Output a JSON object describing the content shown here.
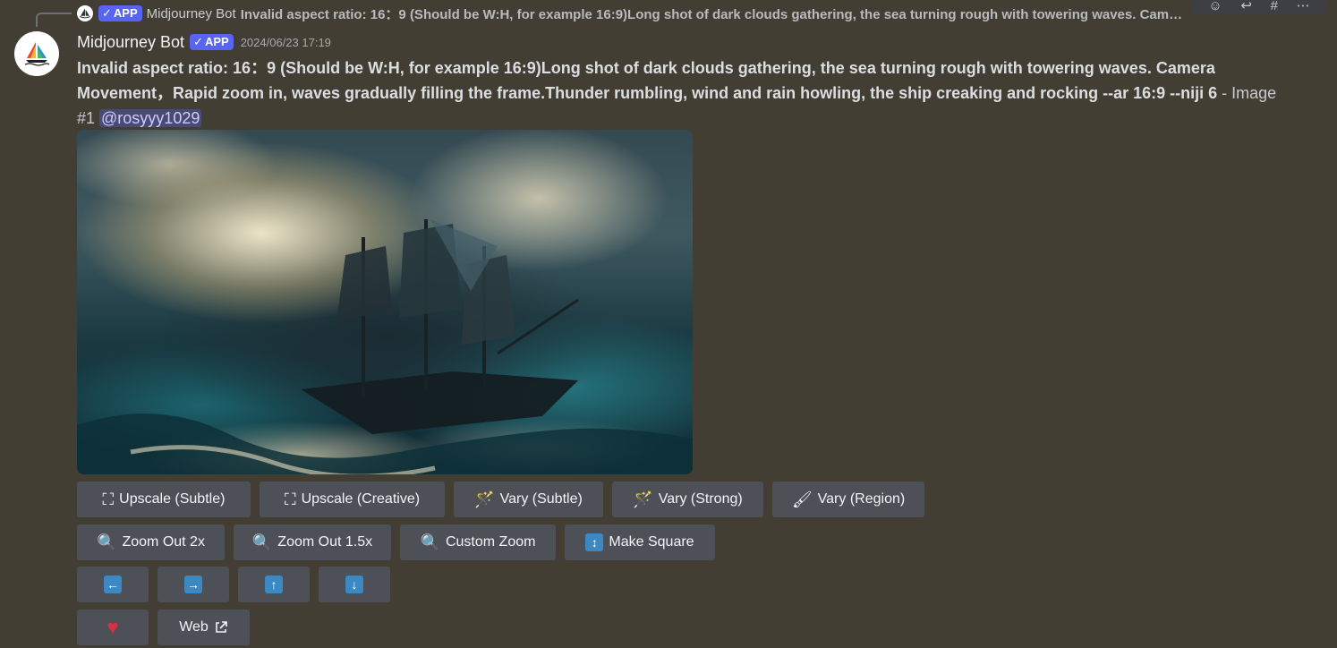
{
  "reply": {
    "badge": "APP",
    "author": "Midjourney Bot",
    "text": "Invalid aspect ratio: 16：9 (Should be W:H, for example 16:9)Long shot of dark clouds gathering, the sea turning rough with towering waves. Cam…"
  },
  "message": {
    "author": "Midjourney Bot",
    "badge": "APP",
    "timestamp": "2024/06/23 17:19",
    "bold_text": "Invalid aspect ratio: 16：9 (Should be W:H, for example 16:9)Long shot of dark clouds gathering, the sea turning rough with towering waves. Camera Movement，Rapid zoom in, waves gradually filling the frame.Thunder rumbling, wind and rain howling, the ship creaking and rocking --ar 16:9 --niji 6",
    "suffix": " - Image #1 ",
    "mention": "@rosyyy1029"
  },
  "buttons": {
    "upscale_subtle": "Upscale (Subtle)",
    "upscale_creative": "Upscale (Creative)",
    "vary_subtle": "Vary (Subtle)",
    "vary_strong": "Vary (Strong)",
    "vary_region": "Vary (Region)",
    "zoom_out_2x": "Zoom Out 2x",
    "zoom_out_15x": "Zoom Out 1.5x",
    "custom_zoom": "Custom Zoom",
    "make_square": "Make Square",
    "web": "Web"
  },
  "icons": {
    "upscale": "expand-corners-icon",
    "vary": "magic-wand-icon",
    "region": "paintbrush-icon",
    "zoom": "magnifier-icon",
    "square": "vertical-arrows-icon",
    "left": "arrow-left-icon",
    "right": "arrow-right-icon",
    "up": "arrow-up-icon",
    "down": "arrow-down-icon",
    "favorite": "heart-icon",
    "external": "external-link-icon"
  },
  "colors": {
    "background": "#433e33",
    "button": "#4e5058",
    "badge": "#5865f2",
    "arrow": "#3b88c3",
    "heart": "#dd2e44"
  }
}
